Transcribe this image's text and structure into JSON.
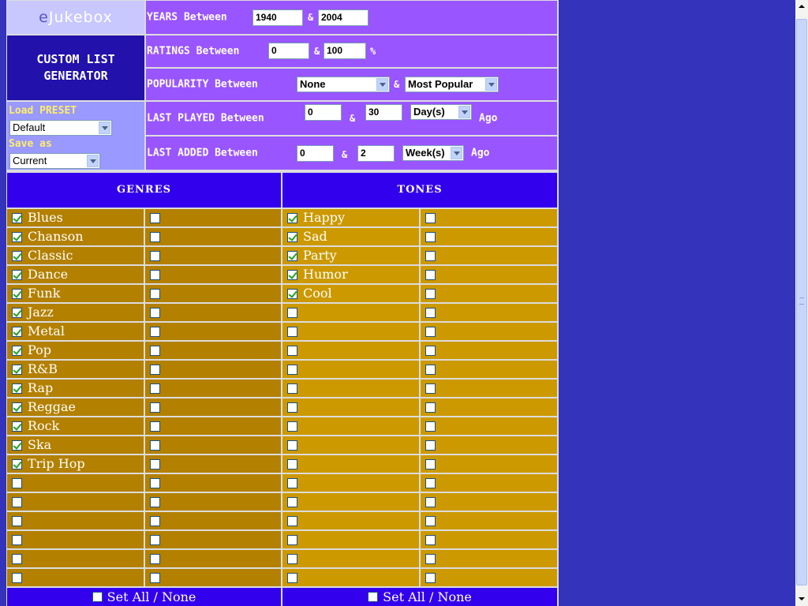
{
  "logo": {
    "e": "e",
    "rest": "Jukebox"
  },
  "title": "CUSTOM LIST\nGENERATOR",
  "preset": {
    "load_label": "Load PRESET",
    "load_value": "Default",
    "save_label": "Save as",
    "save_value": "Current"
  },
  "filters": {
    "years": {
      "label": "YEARS Between",
      "from": "1940",
      "amp": "&",
      "to": "2004"
    },
    "ratings": {
      "label": "RATINGS Between",
      "from": "0",
      "amp": "&",
      "to": "100",
      "unit": "%"
    },
    "popularity": {
      "label": "POPULARITY Between",
      "from": "None",
      "amp": "&",
      "to": "Most Popular"
    },
    "last_played": {
      "label": "LAST PLAYED Between",
      "from": "0",
      "amp": "&",
      "to": "30",
      "unit": "Day(s)",
      "suffix": "Ago"
    },
    "last_added": {
      "label": "LAST ADDED Between",
      "from": "0",
      "amp": "&",
      "to": "2",
      "unit": "Week(s)",
      "suffix": "Ago"
    }
  },
  "genres": {
    "header": "GENRES",
    "items": [
      "Blues",
      "Chanson",
      "Classic",
      "Dance",
      "Funk",
      "Jazz",
      "Metal",
      "Pop",
      "R&B",
      "Rap",
      "Reggae",
      "Rock",
      "Ska",
      "Trip Hop",
      "",
      "",
      "",
      "",
      "",
      ""
    ]
  },
  "tones": {
    "header": "TONES",
    "items": [
      "Happy",
      "Sad",
      "Party",
      "Humor",
      "Cool",
      "",
      "",
      "",
      "",
      "",
      "",
      "",
      "",
      "",
      "",
      "",
      "",
      "",
      "",
      ""
    ]
  },
  "footer": {
    "set_all": "Set All / None"
  },
  "colors": {
    "background": "#3333bb",
    "genre_row": "#b38000",
    "tone_row": "#cc9900",
    "header": "#3300ee",
    "filter_bg": "#9955ff"
  }
}
